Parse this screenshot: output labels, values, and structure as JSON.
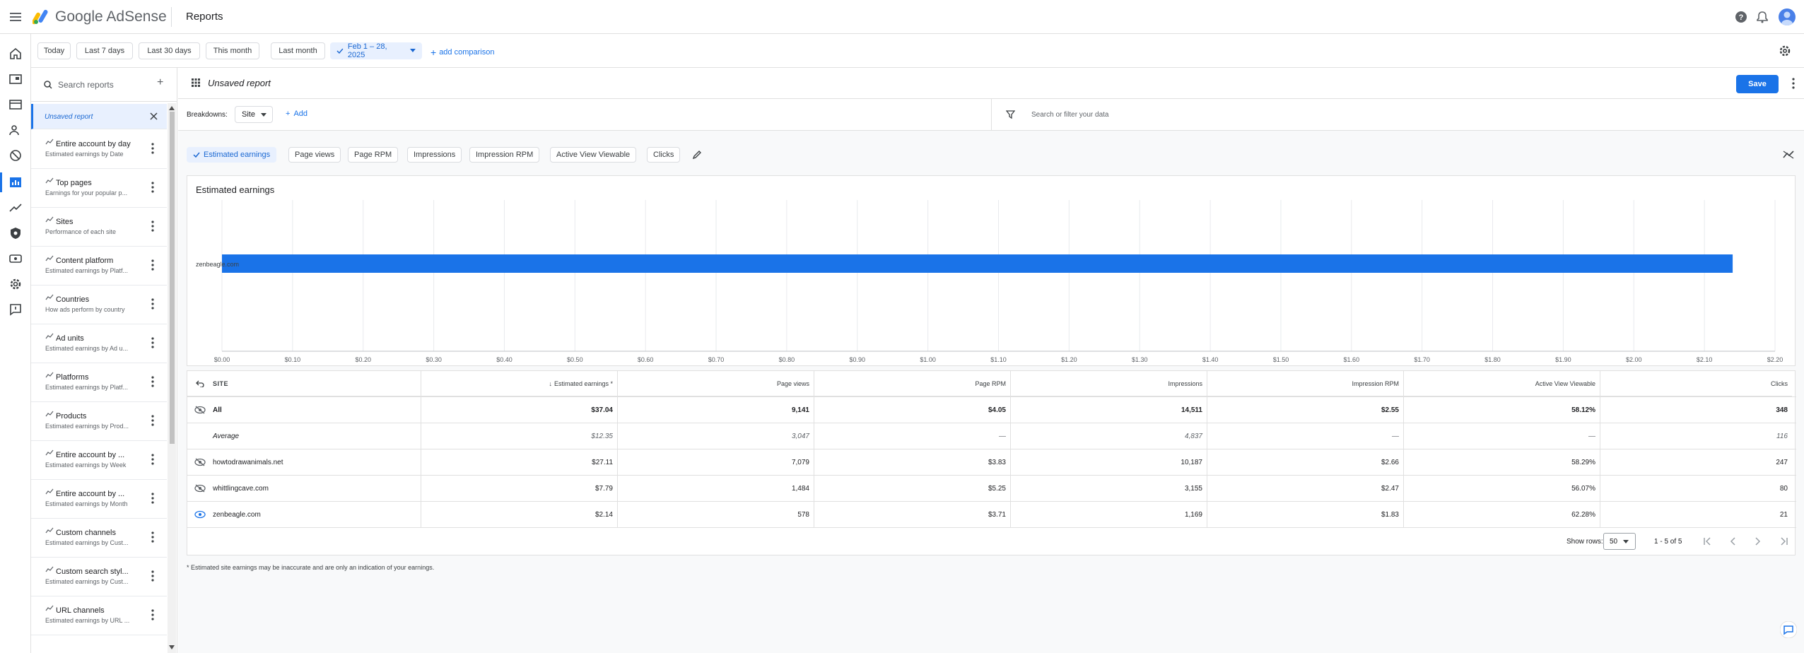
{
  "app": {
    "name": "Google AdSense",
    "page_title": "Reports"
  },
  "date_ranges": [
    "Today",
    "Last 7 days",
    "Last 30 days",
    "This month",
    "Last month"
  ],
  "selected_range": "Feb 1 – 28, 2025",
  "add_comparison": "add comparison",
  "reports_panel": {
    "search_placeholder": "Search reports",
    "active_item": "Unsaved report",
    "items": [
      {
        "title": "Entire account by day",
        "sub": "Estimated earnings by Date"
      },
      {
        "title": "Top pages",
        "sub": "Earnings for your popular p..."
      },
      {
        "title": "Sites",
        "sub": "Performance of each site"
      },
      {
        "title": "Content platform",
        "sub": "Estimated earnings by Platf..."
      },
      {
        "title": "Countries",
        "sub": "How ads perform by country"
      },
      {
        "title": "Ad units",
        "sub": "Estimated earnings by Ad u..."
      },
      {
        "title": "Platforms",
        "sub": "Estimated earnings by Platf..."
      },
      {
        "title": "Products",
        "sub": "Estimated earnings by Prod..."
      },
      {
        "title": "Entire account by ...",
        "sub": "Estimated earnings by Week"
      },
      {
        "title": "Entire account by ...",
        "sub": "Estimated earnings by Month"
      },
      {
        "title": "Custom channels",
        "sub": "Estimated earnings by Cust..."
      },
      {
        "title": "Custom search styl...",
        "sub": "Estimated earnings by Cust..."
      },
      {
        "title": "URL channels",
        "sub": "Estimated earnings by URL ..."
      }
    ]
  },
  "report": {
    "title": "Unsaved report",
    "save_label": "Save",
    "breakdowns_label": "Breakdowns:",
    "breakdown_value": "Site",
    "add_label": "Add",
    "filter_placeholder": "Search or filter your data"
  },
  "metrics": [
    "Estimated earnings",
    "Page views",
    "Page RPM",
    "Impressions",
    "Impression RPM",
    "Active View Viewable",
    "Clicks"
  ],
  "chart_data": {
    "type": "bar",
    "title": "Estimated earnings",
    "orientation": "horizontal",
    "categories": [
      "zenbeagle.com"
    ],
    "values": [
      2.14
    ],
    "xlim": [
      0,
      2.2
    ],
    "x_ticks": [
      "$0.00",
      "$0.10",
      "$0.20",
      "$0.30",
      "$0.40",
      "$0.50",
      "$0.60",
      "$0.70",
      "$0.80",
      "$0.90",
      "$1.00",
      "$1.10",
      "$1.20",
      "$1.30",
      "$1.40",
      "$1.50",
      "$1.60",
      "$1.70",
      "$1.80",
      "$1.90",
      "$2.00",
      "$2.10",
      "$2.20"
    ],
    "bar_color": "#1a73e8",
    "grid": true
  },
  "table": {
    "columns": [
      "SITE",
      "Estimated earnings *",
      "Page views",
      "Page RPM",
      "Impressions",
      "Impression RPM",
      "Active View Viewable",
      "Clicks"
    ],
    "rows": [
      {
        "site": "All",
        "values": [
          "$37.04",
          "9,141",
          "$4.05",
          "14,511",
          "$2.55",
          "58.12%",
          "348"
        ],
        "bold": true,
        "visible": false
      },
      {
        "site": "Average",
        "values": [
          "$12.35",
          "3,047",
          "—",
          "4,837",
          "—",
          "—",
          "116"
        ],
        "italic": true
      },
      {
        "site": "howtodrawanimals.net",
        "values": [
          "$27.11",
          "7,079",
          "$3.83",
          "10,187",
          "$2.66",
          "58.29%",
          "247"
        ],
        "visible": false
      },
      {
        "site": "whittlingcave.com",
        "values": [
          "$7.79",
          "1,484",
          "$5.25",
          "3,155",
          "$2.47",
          "56.07%",
          "80"
        ],
        "visible": false
      },
      {
        "site": "zenbeagle.com",
        "values": [
          "$2.14",
          "578",
          "$3.71",
          "1,169",
          "$1.83",
          "62.28%",
          "21"
        ],
        "visible": true
      }
    ],
    "show_rows_label": "Show rows:",
    "show_rows_value": "50",
    "range_label": "1 - 5 of 5",
    "footnote": "* Estimated site earnings may be inaccurate and are only an indication of your earnings."
  }
}
